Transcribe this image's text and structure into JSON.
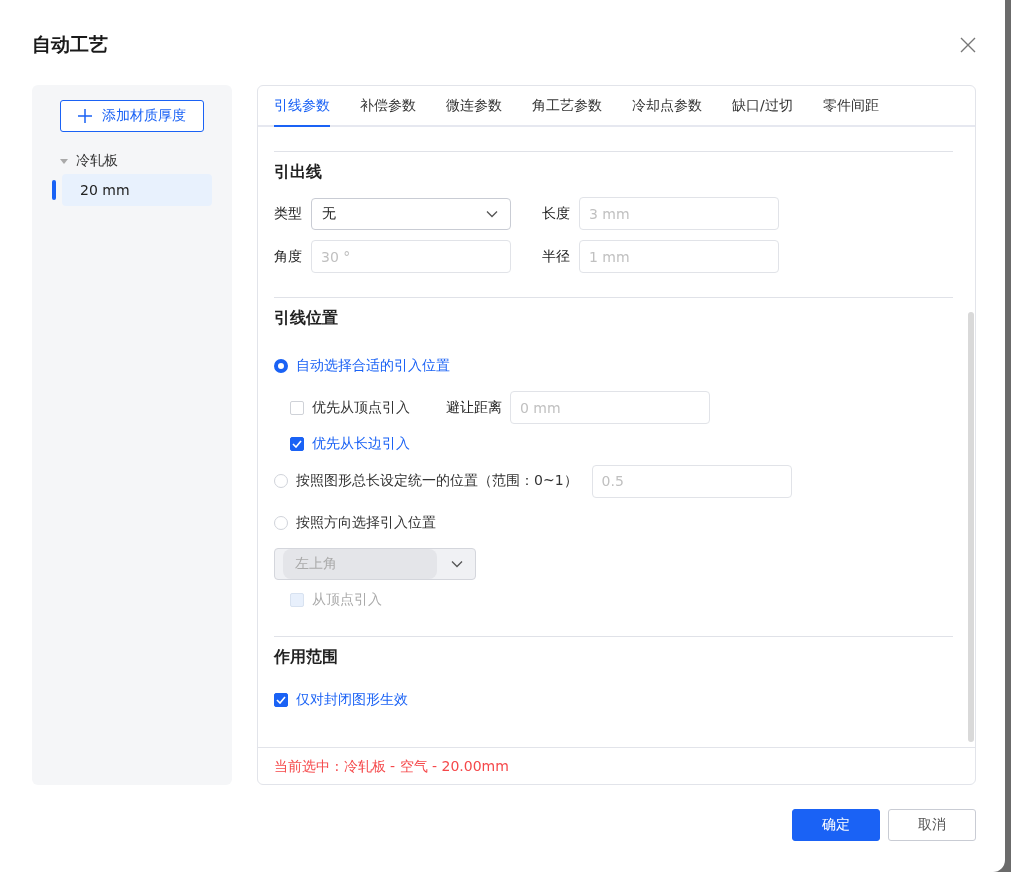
{
  "dialog": {
    "title": "自动工艺"
  },
  "sidebar": {
    "add_button": "添加材质厚度",
    "tree": [
      {
        "label": "冷轧板",
        "expanded": true,
        "children": [
          {
            "label": "20 mm",
            "selected": true
          }
        ]
      }
    ]
  },
  "tabs": [
    {
      "label": "引线参数",
      "selected": true
    },
    {
      "label": "补偿参数",
      "selected": false
    },
    {
      "label": "微连参数",
      "selected": false
    },
    {
      "label": "角工艺参数",
      "selected": false
    },
    {
      "label": "冷却点参数",
      "selected": false
    },
    {
      "label": "缺口/过切",
      "selected": false
    },
    {
      "label": "零件间距",
      "selected": false
    }
  ],
  "lead_line": {
    "title": "引出线",
    "fields": [
      {
        "label": "类型",
        "kind": "select",
        "value": "无"
      },
      {
        "label": "长度",
        "kind": "input",
        "placeholder": "3 mm"
      },
      {
        "label": "角度",
        "kind": "input",
        "placeholder": "30 °"
      },
      {
        "label": "半径",
        "kind": "input",
        "placeholder": "1 mm"
      }
    ]
  },
  "lead_position": {
    "title": "引线位置",
    "options": [
      {
        "label": "自动选择合适的引入位置",
        "selected": true,
        "checks": [
          {
            "label": "优先从顶点引入",
            "checked": false,
            "disabled": false,
            "field": {
              "label": "避让距离",
              "placeholder": "0 mm"
            }
          },
          {
            "label": "优先从长边引入",
            "checked": true,
            "disabled": false
          }
        ]
      },
      {
        "label": "按照图形总长设定统一的位置（范围：0~1）",
        "selected": false,
        "field": {
          "placeholder": "0.5"
        }
      },
      {
        "label": "按照方向选择引入位置",
        "selected": false,
        "select": {
          "value": "左上角",
          "disabled": true
        },
        "checks": [
          {
            "label": "从顶点引入",
            "checked": false,
            "disabled": true
          }
        ]
      }
    ]
  },
  "scope": {
    "title": "作用范围",
    "checks": [
      {
        "label": "仅对封闭图形生效",
        "checked": true,
        "disabled": false
      }
    ]
  },
  "status": "当前选中 : 冷轧板 - 空气 - 20.00mm",
  "buttons": [
    {
      "label": "确定",
      "kind": "primary"
    },
    {
      "label": "取消",
      "kind": "default"
    }
  ]
}
